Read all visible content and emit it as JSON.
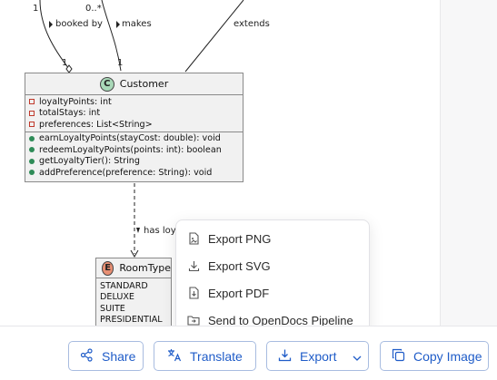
{
  "diagram": {
    "relations": {
      "booked_by": "booked by",
      "makes": "makes",
      "extends": "extends",
      "has_loy": "has loy",
      "mult_left_top": "1",
      "mult_mid_top": "0..*",
      "mult_left_bottom": "1",
      "mult_mid_bottom": "1"
    },
    "customer": {
      "badge": "C",
      "name": "Customer",
      "attributes": [
        "loyaltyPoints: int",
        "totalStays: int",
        "preferences: List<String>"
      ],
      "methods": [
        "earnLoyaltyPoints(stayCost: double): void",
        "redeemLoyaltyPoints(points: int): boolean",
        "getLoyaltyTier(): String",
        "addPreference(preference: String): void"
      ]
    },
    "room_type": {
      "badge": "E",
      "name": "RoomType",
      "values": [
        "STANDARD",
        "DELUXE",
        "SUITE",
        "PRESIDENTIAL"
      ]
    }
  },
  "export_menu": {
    "items": [
      {
        "label": "Export PNG",
        "icon": "image-file-icon"
      },
      {
        "label": "Export SVG",
        "icon": "download-icon"
      },
      {
        "label": "Export PDF",
        "icon": "pdf-file-icon"
      },
      {
        "label": "Send to OpenDocs Pipeline",
        "icon": "folder-send-icon"
      }
    ]
  },
  "toolbar": {
    "share_label": "Share",
    "translate_label": "Translate",
    "export_label": "Export",
    "copy_label": "Copy Image"
  },
  "colors": {
    "accent": "#1f5cc8",
    "button_border": "#a8bce0",
    "class_fill": "#f1f1f1",
    "class_badge": "#a9d8b8",
    "enum_badge": "#e88f73"
  }
}
